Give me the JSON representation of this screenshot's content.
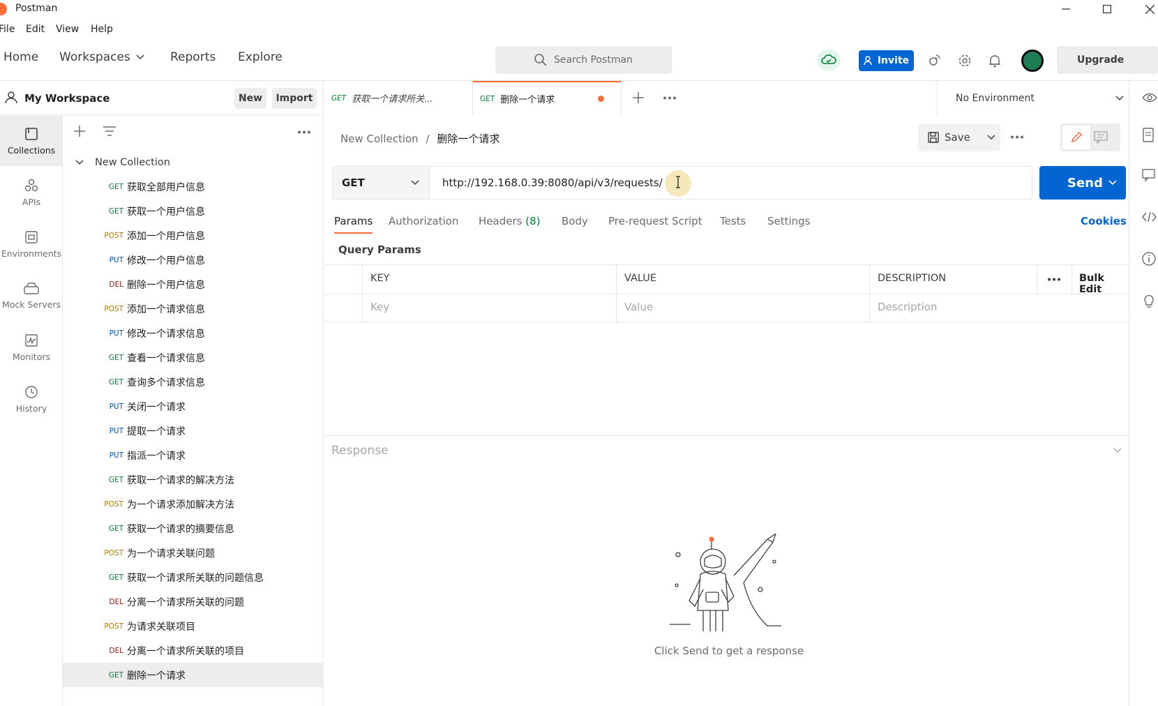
{
  "window": {
    "title": "Postman"
  },
  "menu": [
    "File",
    "Edit",
    "View",
    "Help"
  ],
  "nav": {
    "home": "Home",
    "workspaces": "Workspaces",
    "reports": "Reports",
    "explore": "Explore"
  },
  "search": {
    "placeholder": "Search Postman"
  },
  "header": {
    "invite": "Invite",
    "upgrade": "Upgrade"
  },
  "workspace": {
    "name": "My Workspace",
    "new": "New",
    "import": "Import"
  },
  "rail": [
    "Collections",
    "APIs",
    "Environments",
    "Mock Servers",
    "Monitors",
    "History"
  ],
  "collection": {
    "name": "New Collection",
    "requests": [
      {
        "method": "GET",
        "name": "获取全部用户信息"
      },
      {
        "method": "GET",
        "name": "获取一个用户信息"
      },
      {
        "method": "POST",
        "name": "添加一个用户信息"
      },
      {
        "method": "PUT",
        "name": "修改一个用户信息"
      },
      {
        "method": "DEL",
        "name": "删除一个用户信息"
      },
      {
        "method": "POST",
        "name": "添加一个请求信息"
      },
      {
        "method": "PUT",
        "name": "修改一个请求信息"
      },
      {
        "method": "GET",
        "name": "查看一个请求信息"
      },
      {
        "method": "GET",
        "name": "查询多个请求信息"
      },
      {
        "method": "PUT",
        "name": "关闭一个请求"
      },
      {
        "method": "PUT",
        "name": "提取一个请求"
      },
      {
        "method": "PUT",
        "name": "指派一个请求"
      },
      {
        "method": "GET",
        "name": "获取一个请求的解决方法"
      },
      {
        "method": "POST",
        "name": "为一个请求添加解决方法"
      },
      {
        "method": "GET",
        "name": "获取一个请求的摘要信息"
      },
      {
        "method": "POST",
        "name": "为一个请求关联问题"
      },
      {
        "method": "GET",
        "name": "获取一个请求所关联的问题信息"
      },
      {
        "method": "DEL",
        "name": "分离一个请求所关联的问题"
      },
      {
        "method": "POST",
        "name": "为请求关联项目"
      },
      {
        "method": "DEL",
        "name": "分离一个请求所关联的项目"
      },
      {
        "method": "GET",
        "name": "删除一个请求"
      }
    ]
  },
  "tabs": [
    {
      "method": "GET",
      "name": "获取一个请求所关..."
    },
    {
      "method": "GET",
      "name": "删除一个请求"
    }
  ],
  "environment": {
    "selected": "No Environment"
  },
  "breadcrumb": {
    "collection": "New Collection",
    "separator": "/",
    "request": "删除一个请求"
  },
  "save": {
    "label": "Save"
  },
  "request": {
    "method": "GET",
    "url": "http://192.168.0.39:8080/api/v3/requests/",
    "send": "Send"
  },
  "subtabs": {
    "params": "Params",
    "authorization": "Authorization",
    "headers": "Headers",
    "headers_count": "(8)",
    "body": "Body",
    "prerequest": "Pre-request Script",
    "tests": "Tests",
    "settings": "Settings",
    "cookies": "Cookies"
  },
  "query_params": {
    "title": "Query Params",
    "columns": {
      "key": "KEY",
      "value": "VALUE",
      "description": "DESCRIPTION"
    },
    "bulk_edit": "Bulk Edit",
    "placeholders": {
      "key": "Key",
      "value": "Value",
      "description": "Description"
    }
  },
  "response": {
    "title": "Response",
    "hint": "Click Send to get a response"
  },
  "colors": {
    "accent": "#ff6c37",
    "primary": "#0265d2",
    "get": "#007f31",
    "post": "#ad7a03",
    "put": "#0053b8",
    "del": "#8e1a10"
  }
}
